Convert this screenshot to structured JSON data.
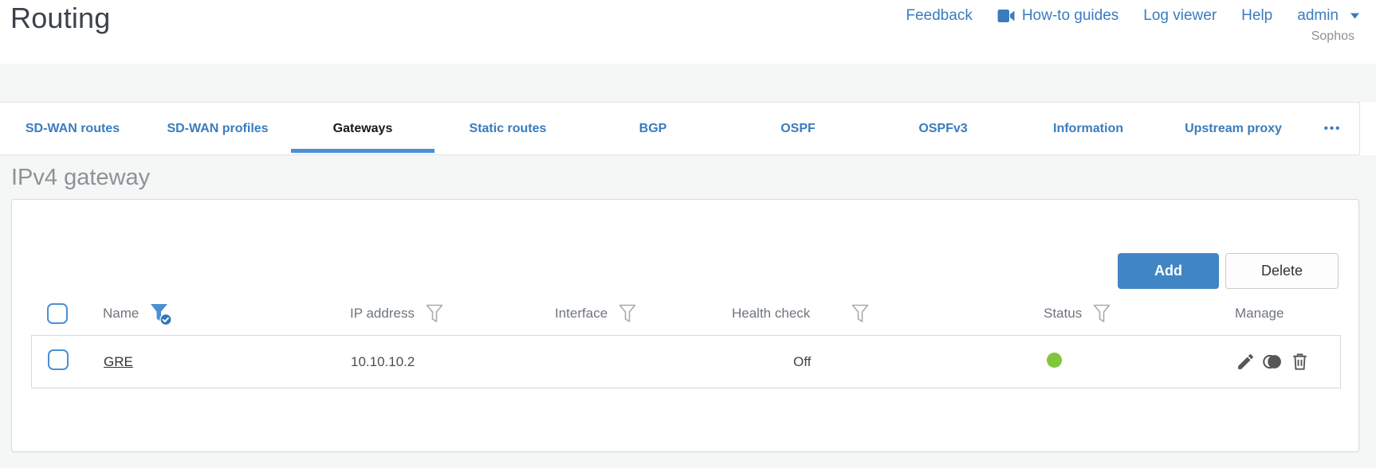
{
  "page": {
    "title": "Routing"
  },
  "topnav": {
    "links": [
      {
        "label": "Feedback"
      },
      {
        "label": "How-to guides",
        "icon": "video-camera-icon"
      },
      {
        "label": "Log viewer"
      },
      {
        "label": "Help"
      }
    ],
    "user": {
      "name": "admin",
      "org": "Sophos"
    }
  },
  "tabs": {
    "items": [
      {
        "label": "SD-WAN routes",
        "active": false
      },
      {
        "label": "SD-WAN profiles",
        "active": false
      },
      {
        "label": "Gateways",
        "active": true
      },
      {
        "label": "Static routes",
        "active": false
      },
      {
        "label": "BGP",
        "active": false
      },
      {
        "label": "OSPF",
        "active": false
      },
      {
        "label": "OSPFv3",
        "active": false
      },
      {
        "label": "Information",
        "active": false
      },
      {
        "label": "Upstream proxy",
        "active": false
      }
    ],
    "more_label": "•••"
  },
  "section": {
    "heading": "IPv4 gateway"
  },
  "toolbar": {
    "add_label": "Add",
    "delete_label": "Delete"
  },
  "table": {
    "columns": [
      {
        "label": "Name",
        "filter": "active"
      },
      {
        "label": "IP address",
        "filter": "inactive"
      },
      {
        "label": "Interface",
        "filter": "inactive"
      },
      {
        "label": "Health check",
        "filter": "inactive"
      },
      {
        "label": "Status",
        "filter": "inactive"
      },
      {
        "label": "Manage",
        "filter": "none"
      }
    ],
    "rows": [
      {
        "name": "GRE",
        "ip_address": "10.10.10.2",
        "interface": "",
        "health_check": "Off",
        "status": "up"
      }
    ]
  },
  "colors": {
    "accent_link": "#3a7cbe",
    "accent_button": "#4186c4",
    "tab_underline": "#4a90d4",
    "status_up_green": "#82c63e"
  }
}
